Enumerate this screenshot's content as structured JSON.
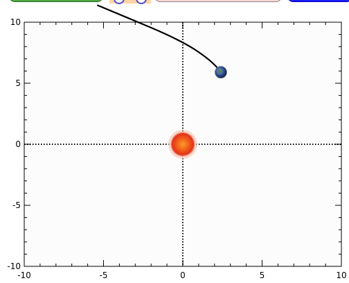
{
  "toolbar": {
    "left_button": {
      "color": "#4fa843"
    },
    "middle_button": {
      "color": "#f2d9d2"
    },
    "right_button": {
      "color": "#1a1aff"
    },
    "speed_panel": {
      "color": "#ffd3a4"
    }
  },
  "chart_data": {
    "type": "scatter",
    "xlim": [
      -10,
      10
    ],
    "ylim": [
      -10,
      10
    ],
    "x_ticks": [
      "-10",
      "-5",
      "0",
      "5",
      "10"
    ],
    "y_ticks": [
      "10",
      "5",
      "0",
      "-5",
      "-10"
    ],
    "grid": false,
    "crosshair_axes": true,
    "sun": {
      "x": 0,
      "y": 0,
      "icon": "sun-icon"
    },
    "earth": {
      "x": 2.4,
      "y": 5.9,
      "icon": "earth-icon"
    },
    "trajectory": [
      {
        "x": -5.4,
        "y": 11.4
      },
      {
        "x": -3.0,
        "y": 10.1
      },
      {
        "x": -1.0,
        "y": 9.0
      },
      {
        "x": 0.5,
        "y": 8.0
      },
      {
        "x": 1.5,
        "y": 7.1
      },
      {
        "x": 2.1,
        "y": 6.4
      },
      {
        "x": 2.4,
        "y": 5.9
      }
    ]
  }
}
